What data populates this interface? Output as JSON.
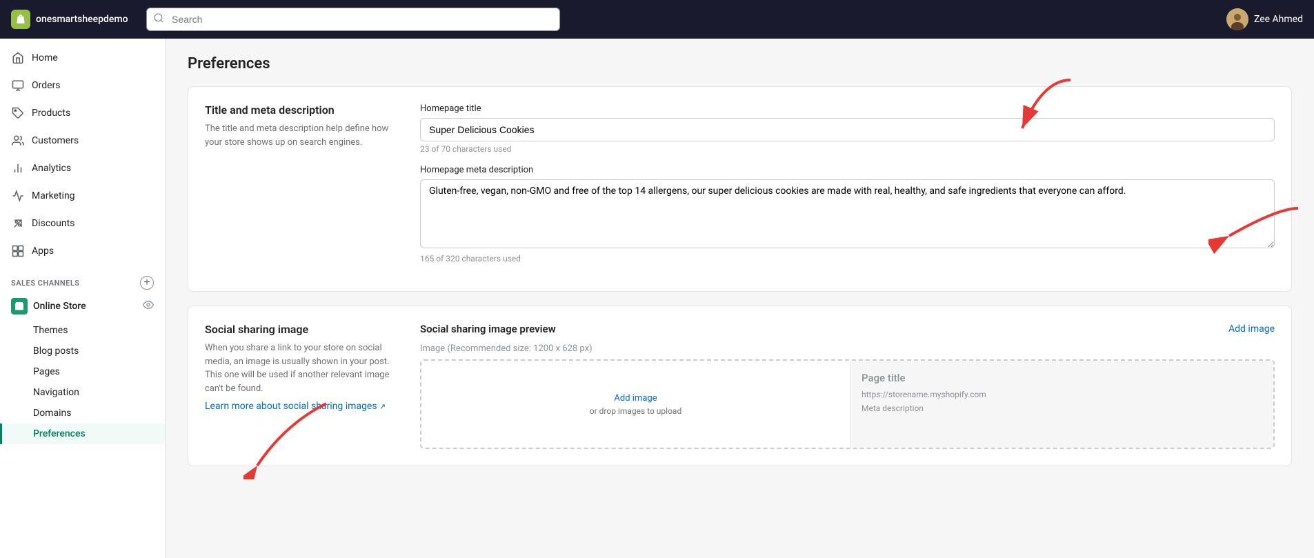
{
  "brand": {
    "store_name": "onesmartsheepdemo"
  },
  "topbar": {
    "search_placeholder": "Search",
    "user_name": "Zee Ahmed"
  },
  "sidebar": {
    "nav_items": [
      {
        "id": "home",
        "label": "Home",
        "icon": "home"
      },
      {
        "id": "orders",
        "label": "Orders",
        "icon": "orders"
      },
      {
        "id": "products",
        "label": "Products",
        "icon": "products"
      },
      {
        "id": "customers",
        "label": "Customers",
        "icon": "customers"
      },
      {
        "id": "analytics",
        "label": "Analytics",
        "icon": "analytics"
      },
      {
        "id": "marketing",
        "label": "Marketing",
        "icon": "marketing"
      },
      {
        "id": "discounts",
        "label": "Discounts",
        "icon": "discounts"
      },
      {
        "id": "apps",
        "label": "Apps",
        "icon": "apps"
      }
    ],
    "sales_channels_label": "SALES CHANNELS",
    "online_store_label": "Online Store",
    "sub_items": [
      {
        "id": "themes",
        "label": "Themes",
        "active": false
      },
      {
        "id": "blog-posts",
        "label": "Blog posts",
        "active": false
      },
      {
        "id": "pages",
        "label": "Pages",
        "active": false
      },
      {
        "id": "navigation",
        "label": "Navigation",
        "active": false
      },
      {
        "id": "domains",
        "label": "Domains",
        "active": false
      },
      {
        "id": "preferences",
        "label": "Preferences",
        "active": true
      }
    ]
  },
  "page": {
    "title": "Preferences"
  },
  "title_meta_section": {
    "section_title": "Title and meta description",
    "section_desc": "The title and meta description help define how your store shows up on search engines.",
    "homepage_title_label": "Homepage title",
    "homepage_title_value": "Super Delicious Cookies",
    "homepage_title_hint": "23 of 70 characters used",
    "meta_desc_label": "Homepage meta description",
    "meta_desc_value": "Gluten-free, vegan, non-GMO and free of the top 14 allergens, our super delicious cookies are made with real, healthy, and safe ingredients that everyone can afford.",
    "meta_desc_hint": "165 of 320 characters used"
  },
  "social_section": {
    "left_title": "Social sharing image",
    "left_desc": "When you share a link to your store on social media, an image is usually shown in your post. This one will be used if another relevant image can't be found.",
    "learn_more_text": "Learn more about social sharing images",
    "right_title": "Social sharing image preview",
    "add_image_label": "Add image",
    "image_label": "Image",
    "image_hint": "(Recommended size: 1200 x 628 px)",
    "upload_link_text": "Add image",
    "upload_hint_text": "or drop images to upload",
    "preview_title": "Page title",
    "preview_url": "https://storename.myshopify.com",
    "preview_desc": "Meta description"
  }
}
